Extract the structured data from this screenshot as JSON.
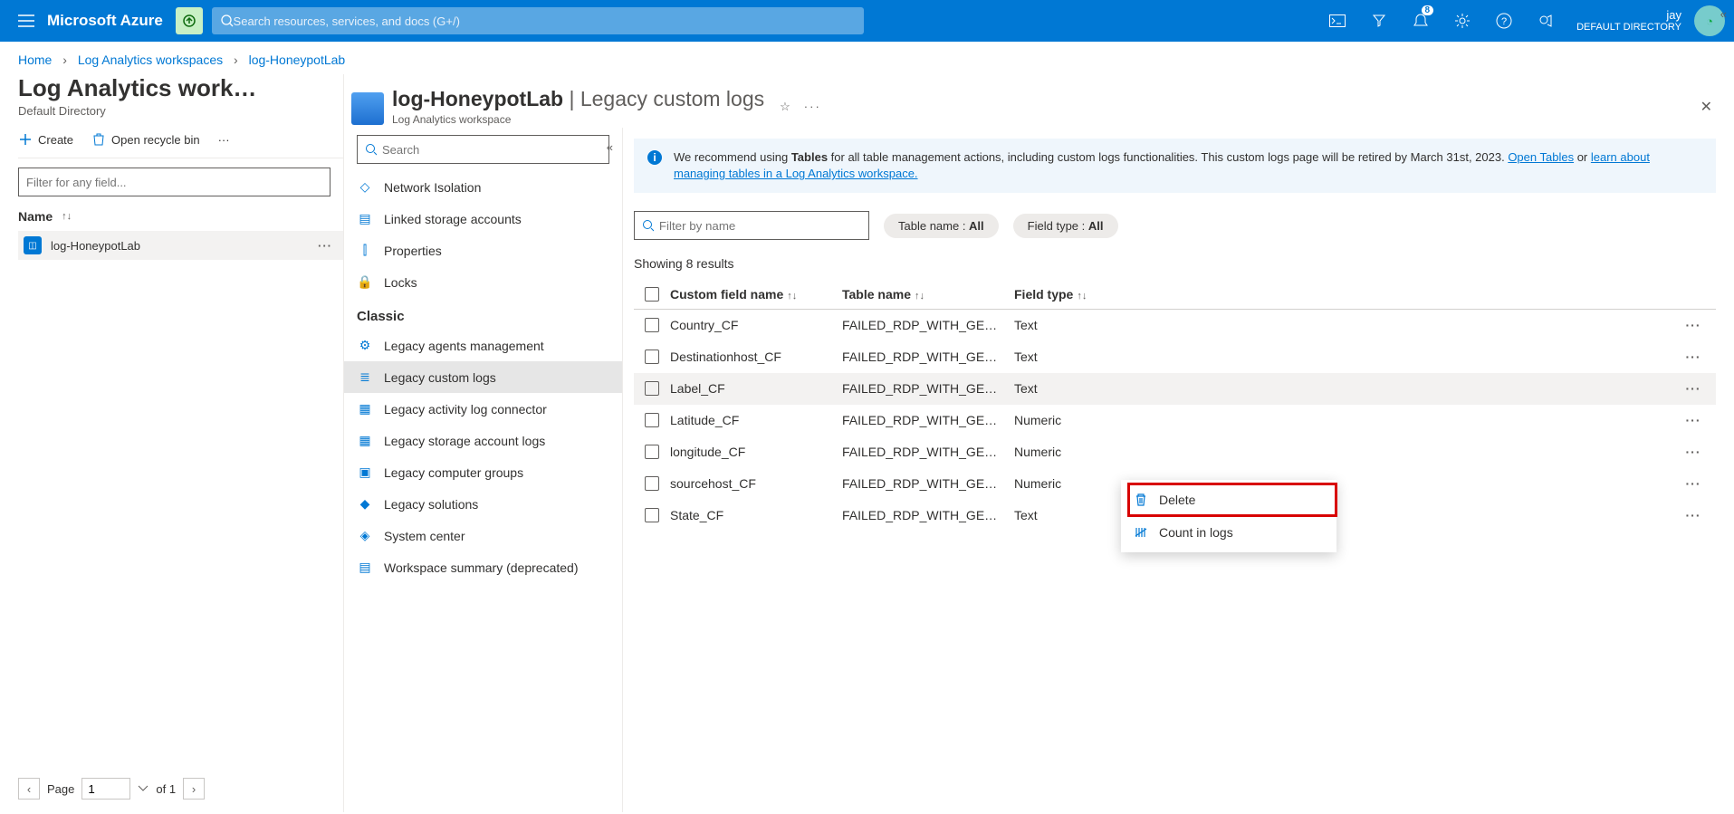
{
  "topbar": {
    "brand": "Microsoft Azure",
    "search_placeholder": "Search resources, services, and docs (G+/)",
    "notification_count": "8",
    "username": "jay",
    "directory": "DEFAULT DIRECTORY"
  },
  "breadcrumb": {
    "items": [
      "Home",
      "Log Analytics workspaces",
      "log-HoneypotLab"
    ]
  },
  "leftpane": {
    "title": "Log Analytics work…",
    "subtitle": "Default Directory",
    "create": "Create",
    "recycle": "Open recycle bin",
    "filter_placeholder": "Filter for any field...",
    "name_header": "Name",
    "item_name": "log-HoneypotLab",
    "page_label": "Page",
    "page_input": "1",
    "page_of": "of 1"
  },
  "midnav": {
    "title": "log-HoneypotLab",
    "subtitle": "Log Analytics workspace",
    "search_placeholder": "Search",
    "items_top": [
      {
        "label": "Network Isolation",
        "icon": "◇"
      },
      {
        "label": "Linked storage accounts",
        "icon": "▤"
      },
      {
        "label": "Properties",
        "icon": "⫿"
      },
      {
        "label": "Locks",
        "icon": "🔒"
      }
    ],
    "section": "Classic",
    "items_classic": [
      {
        "label": "Legacy agents management",
        "icon": "⚙",
        "active": false
      },
      {
        "label": "Legacy custom logs",
        "icon": "≣",
        "active": true
      },
      {
        "label": "Legacy activity log connector",
        "icon": "▦",
        "active": false
      },
      {
        "label": "Legacy storage account logs",
        "icon": "▦",
        "active": false
      },
      {
        "label": "Legacy computer groups",
        "icon": "▣",
        "active": false
      },
      {
        "label": "Legacy solutions",
        "icon": "◆",
        "active": false
      },
      {
        "label": "System center",
        "icon": "◈",
        "active": false
      },
      {
        "label": "Workspace summary (deprecated)",
        "icon": "▤",
        "active": false
      }
    ]
  },
  "rightpane": {
    "title_prefix": "log-HoneypotLab",
    "title_suffix": " | Legacy custom logs",
    "info_text_1": "We recommend using ",
    "info_bold": "Tables",
    "info_text_2": " for all table management actions, including custom logs functionalities. This custom logs page will be retired by March 31st, 2023. ",
    "info_link1": "Open Tables",
    "info_or": " or ",
    "info_link2": "learn about managing tables in a Log Analytics workspace.",
    "filter_placeholder": "Filter by name",
    "pill1_label": "Table name : ",
    "pill1_val": "All",
    "pill2_label": "Field type : ",
    "pill2_val": "All",
    "result_count": "Showing 8 results",
    "col1": "Custom field name",
    "col2": "Table name",
    "col3": "Field type",
    "rows": [
      {
        "name": "Country_CF",
        "table": "FAILED_RDP_WITH_GE…",
        "type": "Text",
        "hl": false
      },
      {
        "name": "Destinationhost_CF",
        "table": "FAILED_RDP_WITH_GE…",
        "type": "Text",
        "hl": false
      },
      {
        "name": "Label_CF",
        "table": "FAILED_RDP_WITH_GE…",
        "type": "Text",
        "hl": true
      },
      {
        "name": "Latitude_CF",
        "table": "FAILED_RDP_WITH_GE…",
        "type": "Numeric",
        "hl": false
      },
      {
        "name": "longitude_CF",
        "table": "FAILED_RDP_WITH_GE…",
        "type": "Numeric",
        "hl": false
      },
      {
        "name": "sourcehost_CF",
        "table": "FAILED_RDP_WITH_GE…",
        "type": "Numeric",
        "hl": false
      },
      {
        "name": "State_CF",
        "table": "FAILED_RDP_WITH_GE…",
        "type": "Text",
        "hl": false
      }
    ],
    "ctx_delete": "Delete",
    "ctx_count": "Count in logs"
  }
}
